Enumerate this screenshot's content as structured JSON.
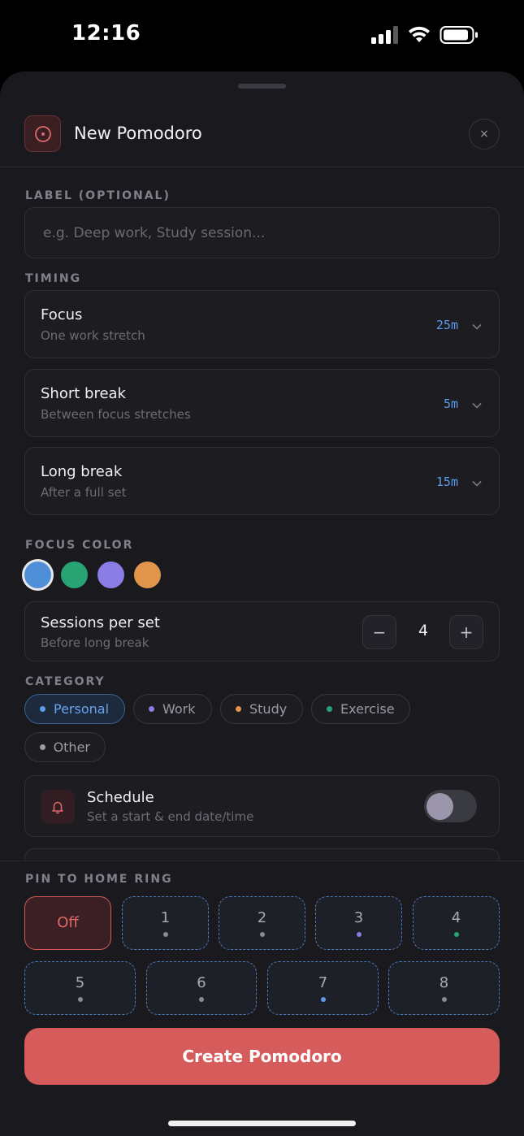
{
  "status_bar": {
    "time": "12:16"
  },
  "header": {
    "title": "New Pomodoro",
    "close_label": "×"
  },
  "label_section": {
    "heading": "LABEL (OPTIONAL)",
    "placeholder": "e.g. Deep work, Study session..."
  },
  "timing": {
    "heading": "TIMING",
    "rows": [
      {
        "label": "Focus",
        "sub": "One work stretch",
        "value": "25m"
      },
      {
        "label": "Short break",
        "sub": "Between focus stretches",
        "value": "5m"
      },
      {
        "label": "Long break",
        "sub": "After a full set",
        "value": "15m"
      }
    ]
  },
  "focus_color": {
    "heading": "FOCUS COLOR",
    "colors": [
      "#4f8fd8",
      "#27a374",
      "#8a7de4",
      "#e0954a"
    ],
    "selected": 0
  },
  "sessions": {
    "label": "Sessions per set",
    "sub": "Before long break",
    "value": "4",
    "minus": "−",
    "plus": "+"
  },
  "category": {
    "heading": "CATEGORY",
    "items": [
      {
        "label": "Personal",
        "color": "#5d9ce8",
        "active": true
      },
      {
        "label": "Work",
        "color": "#8a7de4"
      },
      {
        "label": "Study",
        "color": "#e0954a"
      },
      {
        "label": "Exercise",
        "color": "#27a374"
      },
      {
        "label": "Other",
        "color": "#9a9aa6"
      }
    ]
  },
  "schedule": {
    "label": "Schedule",
    "sub": "Set a start & end date/time",
    "enabled": false
  },
  "pin": {
    "heading": "PIN TO HOME RING",
    "off_label": "Off",
    "slots": [
      {
        "label": "1",
        "dot": "#8a8a94"
      },
      {
        "label": "2",
        "dot": "#8a8a94"
      },
      {
        "label": "3",
        "dot": "#8a7de4"
      },
      {
        "label": "4",
        "dot": "#27a374"
      },
      {
        "label": "5",
        "dot": "#8a8a94"
      },
      {
        "label": "6",
        "dot": "#8a8a94"
      },
      {
        "label": "7",
        "dot": "#5d9ce8"
      },
      {
        "label": "8",
        "dot": "#8a8a94"
      }
    ]
  },
  "create_button": "Create Pomodoro"
}
